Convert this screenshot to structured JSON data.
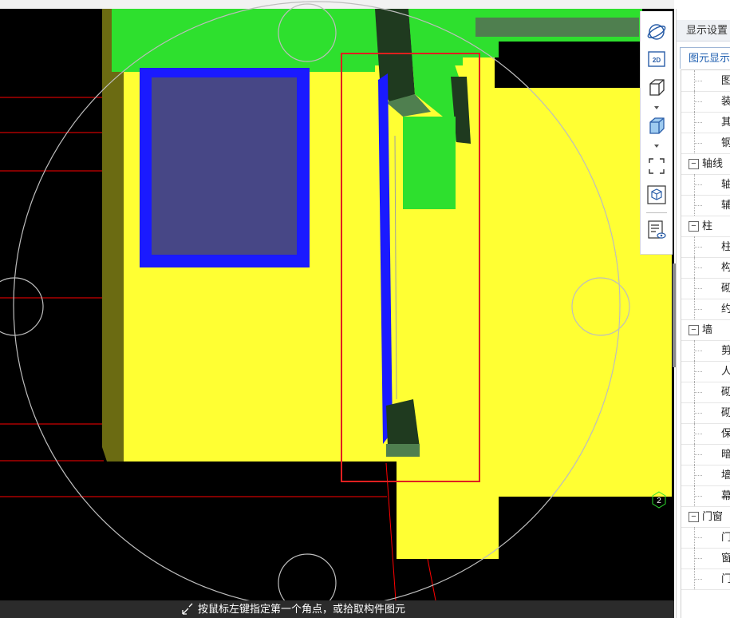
{
  "status_bar": {
    "hint": "按鼠标左键指定第一个角点，或拾取构件图元"
  },
  "viewport": {
    "axis_label": "2"
  },
  "toolbar": {
    "tools": [
      {
        "name": "dynamic-observe",
        "icon": "orbit-icon"
      },
      {
        "name": "2d-view",
        "icon": "2d-icon",
        "text": "2D"
      },
      {
        "name": "wireframe-view",
        "icon": "wire-cube-icon"
      },
      {
        "name": "shaded-view",
        "icon": "solid-cube-icon"
      },
      {
        "name": "fit-screen",
        "icon": "fullscreen-icon"
      },
      {
        "name": "component-view",
        "icon": "cube-box-icon"
      },
      {
        "name": "display-settings",
        "icon": "list-eye-icon"
      }
    ]
  },
  "panel": {
    "header": "显示设置",
    "tab": "图元显示",
    "rows": [
      {
        "label": "图",
        "level": 1
      },
      {
        "label": "装",
        "level": 1
      },
      {
        "label": "其",
        "level": 1
      },
      {
        "label": "钢",
        "level": 1
      },
      {
        "label": "轴线",
        "level": 0,
        "toggle": "−"
      },
      {
        "label": "轴",
        "level": 1
      },
      {
        "label": "辅",
        "level": 1
      },
      {
        "label": "柱",
        "level": 0,
        "toggle": "−"
      },
      {
        "label": "柱",
        "level": 1
      },
      {
        "label": "构",
        "level": 1
      },
      {
        "label": "砌",
        "level": 1
      },
      {
        "label": "约",
        "level": 1
      },
      {
        "label": "墙",
        "level": 0,
        "toggle": "−"
      },
      {
        "label": "剪",
        "level": 1
      },
      {
        "label": "人",
        "level": 1
      },
      {
        "label": "砌",
        "level": 1
      },
      {
        "label": "砌",
        "level": 1
      },
      {
        "label": "保",
        "level": 1
      },
      {
        "label": "暗",
        "level": 1
      },
      {
        "label": "墙",
        "level": 1
      },
      {
        "label": "幕",
        "level": 1
      },
      {
        "label": "门窗",
        "level": 0,
        "toggle": "−"
      },
      {
        "label": "门",
        "level": 1
      },
      {
        "label": "窗",
        "level": 1
      },
      {
        "label": "门",
        "level": 1
      }
    ]
  },
  "colors": {
    "slab": "#ffff33",
    "beam": "#2ee02e",
    "beam_dark": "#1f3a1f",
    "window_frame": "#1a1aff",
    "window_glass": "#474786",
    "selection": "#e02020",
    "grid_line": "#ff0000",
    "navigator_circle": "#bdbdbd"
  }
}
